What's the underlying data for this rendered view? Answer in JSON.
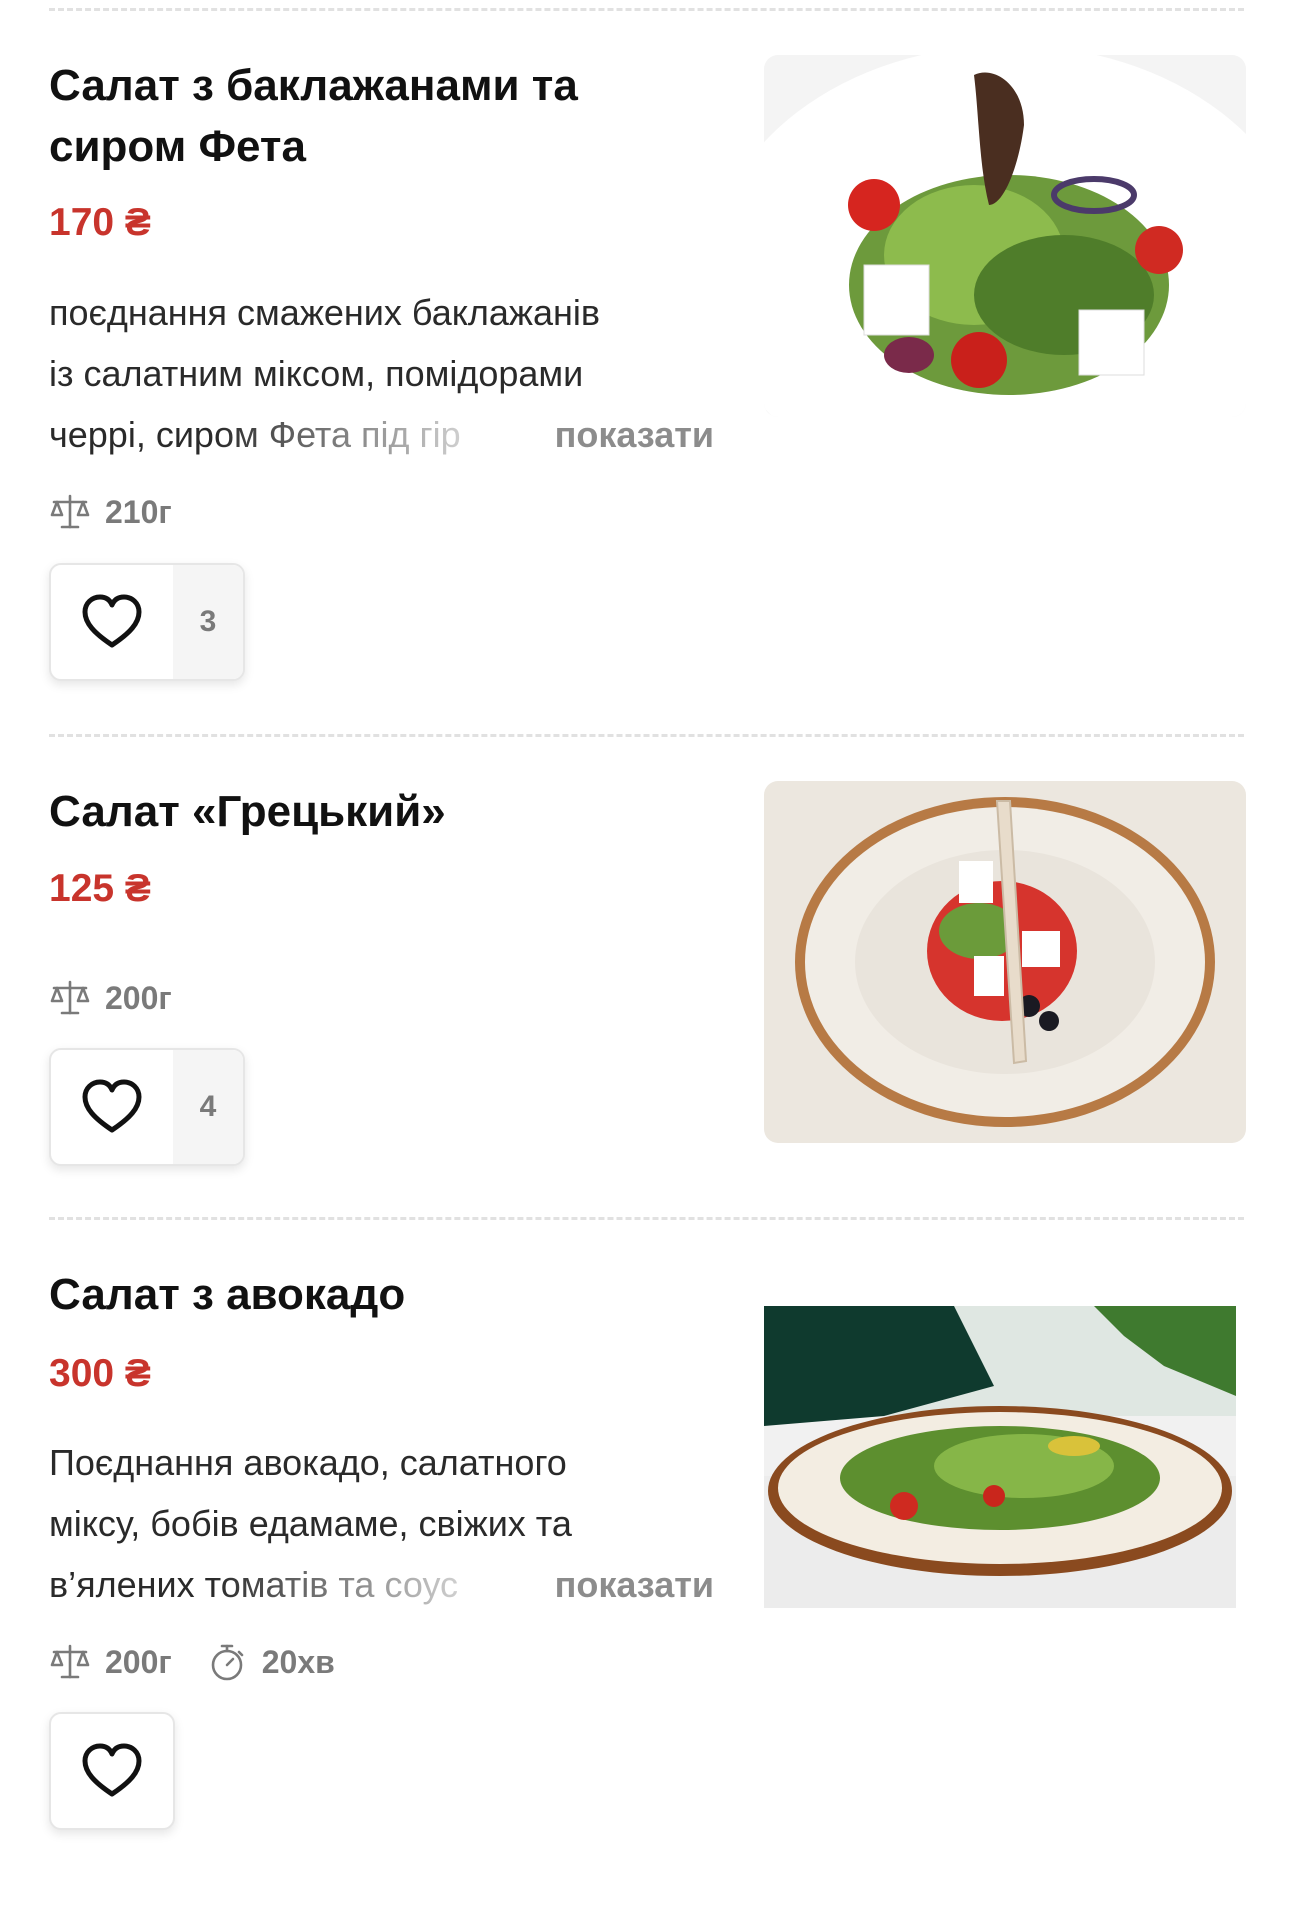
{
  "items": [
    {
      "title_line1": "Салат з баклажанами та",
      "title_line2": "сиром Фета",
      "price": "170 ₴",
      "desc_line1": "поєднання смажених баклажанів",
      "desc_line2": "із салатним міксом, помідорами",
      "desc_line3": "черрі, сиром Фета під гір",
      "more_label": "показати",
      "weight": "210г",
      "likes": "3"
    },
    {
      "title_line1": "Салат «Грецький»",
      "price": "125 ₴",
      "weight": "200г",
      "likes": "4"
    },
    {
      "title_line1": "Салат з авокадо",
      "price": "300 ₴",
      "desc_line1": "Поєднання авокадо, салатного",
      "desc_line2": "міксу, бобів едамаме, свіжих та",
      "desc_line3": "в’ялених томатів та соус",
      "more_label": "показати",
      "weight": "200г",
      "time": "20хв"
    }
  ],
  "icons": {
    "weight": "scale-icon",
    "time": "stopwatch-icon",
    "like": "heart-icon"
  },
  "colors": {
    "price": "#c8342c",
    "text": "#111111",
    "muted": "#7a7a7a"
  }
}
